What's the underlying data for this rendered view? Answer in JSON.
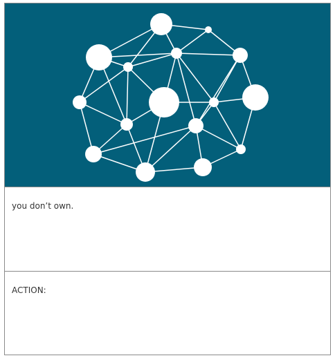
{
  "card": {
    "banner": {
      "background": "#035f7a",
      "icon": "network-graph-icon"
    },
    "section1": {
      "text": "you don’t own."
    },
    "section2": {
      "text": "ACTION:"
    }
  }
}
